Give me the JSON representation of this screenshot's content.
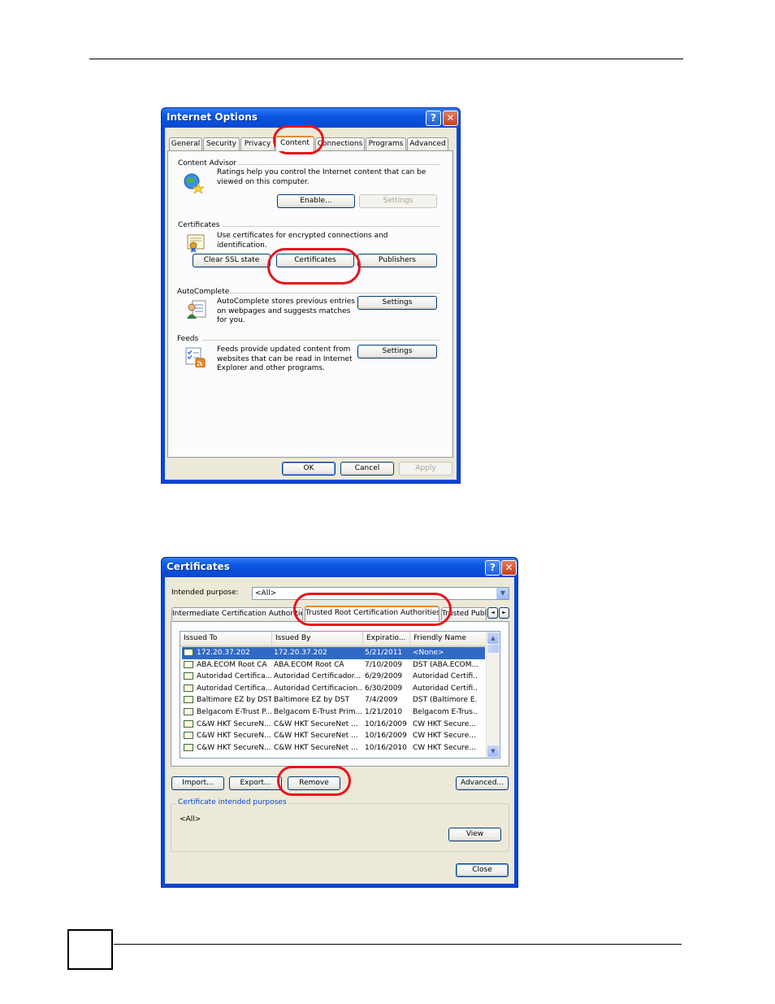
{
  "internet_options": {
    "title": "Internet Options",
    "help_glyph": "?",
    "close_glyph": "✕",
    "tabs": [
      "General",
      "Security",
      "Privacy",
      "Content",
      "Connections",
      "Programs",
      "Advanced"
    ],
    "active_tab": "Content",
    "content_advisor": {
      "heading": "Content Advisor",
      "description": "Ratings help you control the Internet content that can be viewed on this computer.",
      "enable_label": "Enable...",
      "settings_label": "Settings"
    },
    "certificates": {
      "heading": "Certificates",
      "description": "Use certificates for encrypted connections and identification.",
      "clear_ssl_label": "Clear SSL state",
      "certificates_label": "Certificates",
      "publishers_label": "Publishers"
    },
    "autocomplete": {
      "heading": "AutoComplete",
      "description": "AutoComplete stores previous entries on webpages and suggests matches for you.",
      "settings_label": "Settings"
    },
    "feeds": {
      "heading": "Feeds",
      "description": "Feeds provide updated content from websites that can be read in Internet Explorer and other programs.",
      "settings_label": "Settings"
    },
    "ok_label": "OK",
    "cancel_label": "Cancel",
    "apply_label": "Apply"
  },
  "certificates_dialog": {
    "title": "Certificates",
    "help_glyph": "?",
    "close_glyph": "✕",
    "intended_purpose_label": "Intended purpose:",
    "intended_purpose_value": "<All>",
    "tabs": [
      "Intermediate Certification Authorities",
      "Trusted Root Certification Authorities",
      "Trusted Publ"
    ],
    "active_tab": "Trusted Root Certification Authorities",
    "tab_scroll_left": "◄",
    "tab_scroll_right": "►",
    "columns": [
      "Issued To",
      "Issued By",
      "Expiratio...",
      "Friendly Name"
    ],
    "rows": [
      [
        "172.20.37.202",
        "172.20.37.202",
        "5/21/2011",
        "<None>"
      ],
      [
        "ABA.ECOM Root CA",
        "ABA.ECOM Root CA",
        "7/10/2009",
        "DST (ABA.ECOM..."
      ],
      [
        "Autoridad Certifica...",
        "Autoridad Certificador...",
        "6/29/2009",
        "Autoridad Certifi..."
      ],
      [
        "Autoridad Certifica...",
        "Autoridad Certificacion...",
        "6/30/2009",
        "Autoridad Certifi..."
      ],
      [
        "Baltimore EZ by DST",
        "Baltimore EZ by DST",
        "7/4/2009",
        "DST (Baltimore E..."
      ],
      [
        "Belgacom E-Trust P...",
        "Belgacom E-Trust Prim...",
        "1/21/2010",
        "Belgacom E-Trus..."
      ],
      [
        "C&W HKT SecureN...",
        "C&W HKT SecureNet ...",
        "10/16/2009",
        "CW HKT Secure..."
      ],
      [
        "C&W HKT SecureN...",
        "C&W HKT SecureNet ...",
        "10/16/2009",
        "CW HKT Secure..."
      ],
      [
        "C&W HKT SecureN...",
        "C&W HKT SecureNet ...",
        "10/16/2010",
        "CW HKT Secure..."
      ]
    ],
    "import_label": "Import...",
    "export_label": "Export...",
    "remove_label": "Remove",
    "advanced_label": "Advanced...",
    "purposes_legend": "Certificate intended purposes",
    "purposes_value": "<All>",
    "view_label": "View",
    "close_label": "Close"
  },
  "colors": {
    "xp_title_blue": "#0a56e2",
    "dialog_face": "#ece9d8",
    "highlight_oval": "#e8141b",
    "selection_blue": "#316ac5"
  }
}
